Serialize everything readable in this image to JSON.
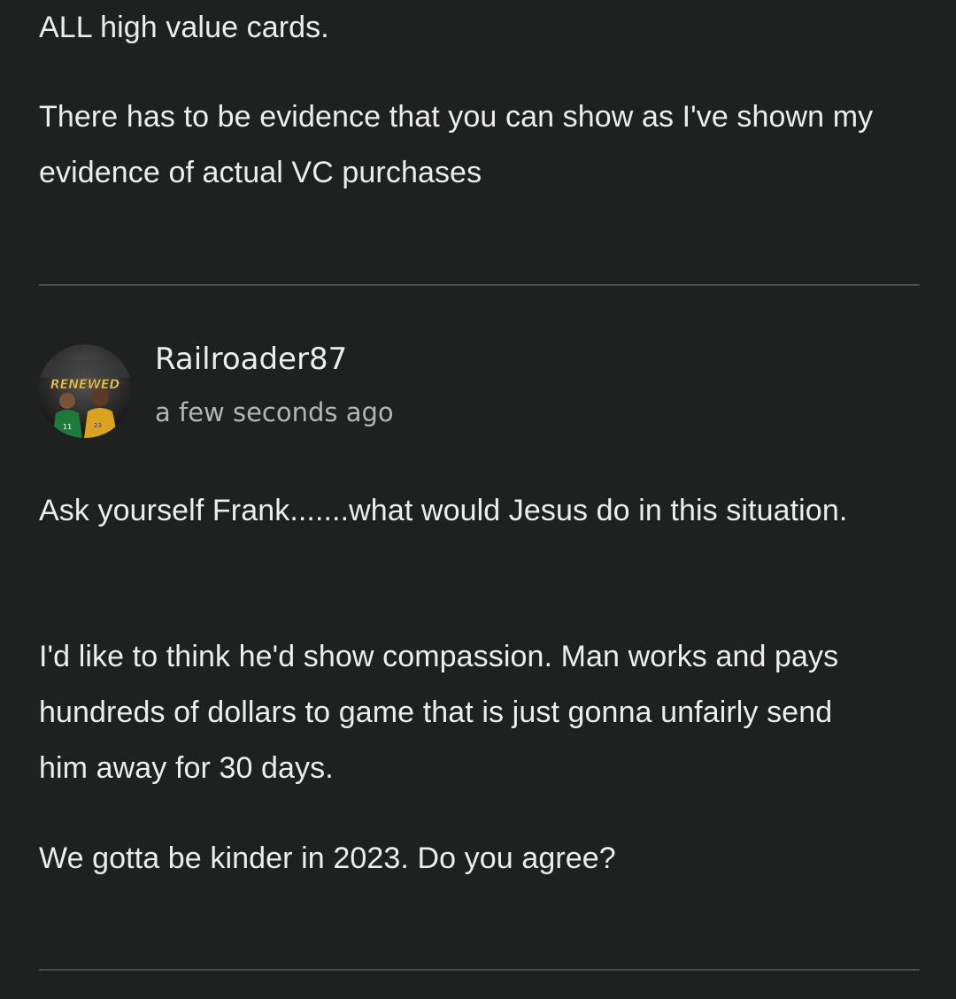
{
  "previous_comment": {
    "paragraphs": [
      "ALL high value cards.",
      "There has to be evidence that you can show as I've shown my evidence of actual VC purchases"
    ]
  },
  "comment": {
    "author": "Railroader87",
    "timestamp": "a few seconds ago",
    "avatar": {
      "icon": "user-avatar-icon",
      "text": "RENEWED"
    },
    "paragraphs": [
      "Ask yourself Frank.......what would Jesus do in this situation.",
      "I'd like to think he'd show compassion. Man works and pays hundreds of dollars to game that is just gonna unfairly send him away for 30 days.",
      "We gotta be kinder in 2023. Do you agree?"
    ]
  },
  "colors": {
    "background": "#1f2020",
    "text": "#ecedec",
    "secondary_text": "#b4b5b4",
    "divider": "#4b4c4c"
  }
}
